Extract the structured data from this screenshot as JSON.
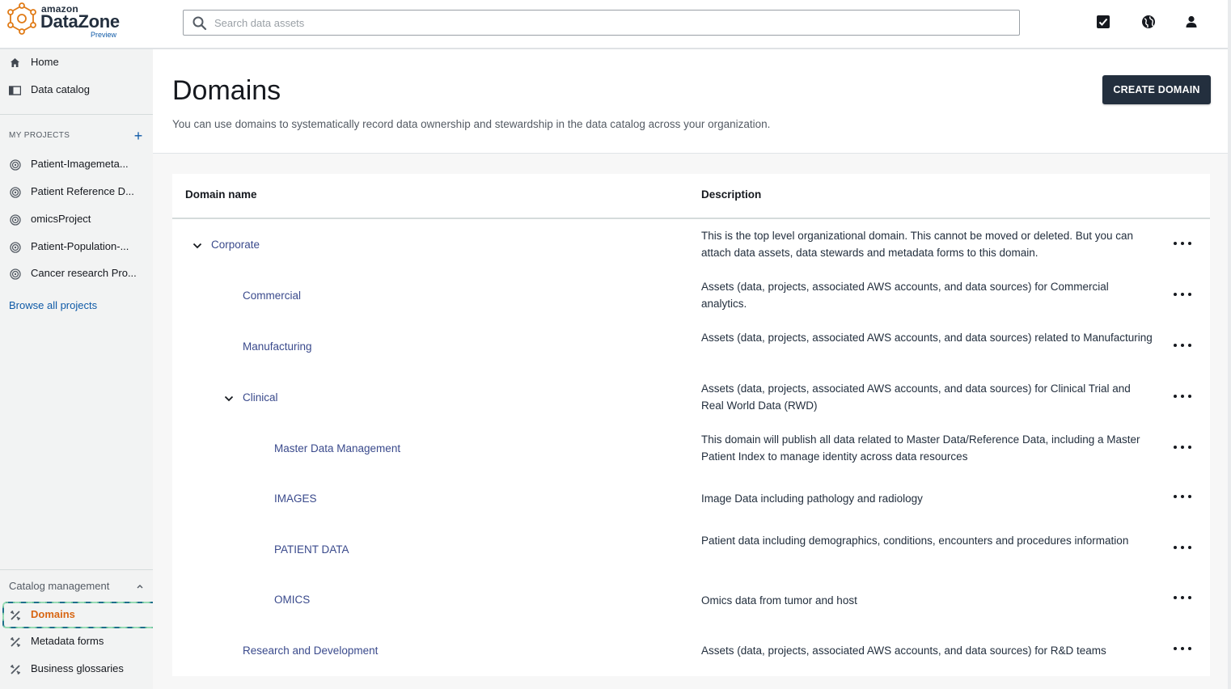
{
  "brand": {
    "top": "amazon",
    "name": "DataZone",
    "tag": "Preview"
  },
  "search": {
    "placeholder": "Search data assets"
  },
  "header_icons": [
    "tasks-checkbox-icon",
    "globe-icon",
    "user-icon"
  ],
  "sidebar": {
    "nav": [
      {
        "label": "Home",
        "icon": "home-icon"
      },
      {
        "label": "Data catalog",
        "icon": "catalog-icon"
      }
    ],
    "projects_heading": "MY PROJECTS",
    "projects": [
      {
        "label": "Patient-Imagemeta..."
      },
      {
        "label": "Patient Reference D..."
      },
      {
        "label": "omicsProject"
      },
      {
        "label": "Patient-Population-..."
      },
      {
        "label": "Cancer research Pro..."
      }
    ],
    "browse_all": "Browse all projects",
    "catalog_heading": "Catalog management",
    "catalog_items": [
      {
        "label": "Domains",
        "active": true
      },
      {
        "label": "Metadata forms"
      },
      {
        "label": "Business glossaries"
      }
    ]
  },
  "page": {
    "title": "Domains",
    "description": "You can use domains to systematically record data ownership and stewardship in the data catalog across your organization.",
    "create_button": "CREATE DOMAIN"
  },
  "table": {
    "headers": {
      "name": "Domain name",
      "description": "Description"
    },
    "rows": [
      {
        "name": "Corporate",
        "level": 0,
        "expanded": true,
        "description": "This is the top level organizational domain. This cannot be moved or deleted. But you can attach data assets, data stewards and metadata forms to this domain."
      },
      {
        "name": "Commercial",
        "level": 1,
        "description": "Assets (data, projects, associated AWS accounts, and data sources) for Commercial analytics."
      },
      {
        "name": "Manufacturing",
        "level": 1,
        "description": "Assets (data, projects, associated AWS accounts, and data sources) related to Manufacturing"
      },
      {
        "name": "Clinical",
        "level": 1,
        "expanded": true,
        "description": "Assets (data, projects, associated AWS accounts, and data sources) for Clinical Trial and Real World Data (RWD)"
      },
      {
        "name": "Master Data Management",
        "level": 2,
        "description": "This domain will publish all data related to Master Data/Reference Data, including a Master Patient Index to manage identity across data resources"
      },
      {
        "name": "IMAGES",
        "level": 2,
        "description": "Image Data including pathology and radiology"
      },
      {
        "name": "PATIENT DATA",
        "level": 2,
        "description": "Patient data including demographics, conditions, encounters and procedures information"
      },
      {
        "name": "OMICS",
        "level": 2,
        "description": "Omics data from tumor and host"
      },
      {
        "name": "Research and Development",
        "level": 1,
        "description": "Assets (data, projects, associated AWS accounts, and data sources) for R&D teams"
      }
    ]
  },
  "colors": {
    "accent_orange": "#d86613",
    "link_blue": "#0f5aa7",
    "domain_link": "#3a4a8c",
    "dark_button": "#232f3e"
  }
}
